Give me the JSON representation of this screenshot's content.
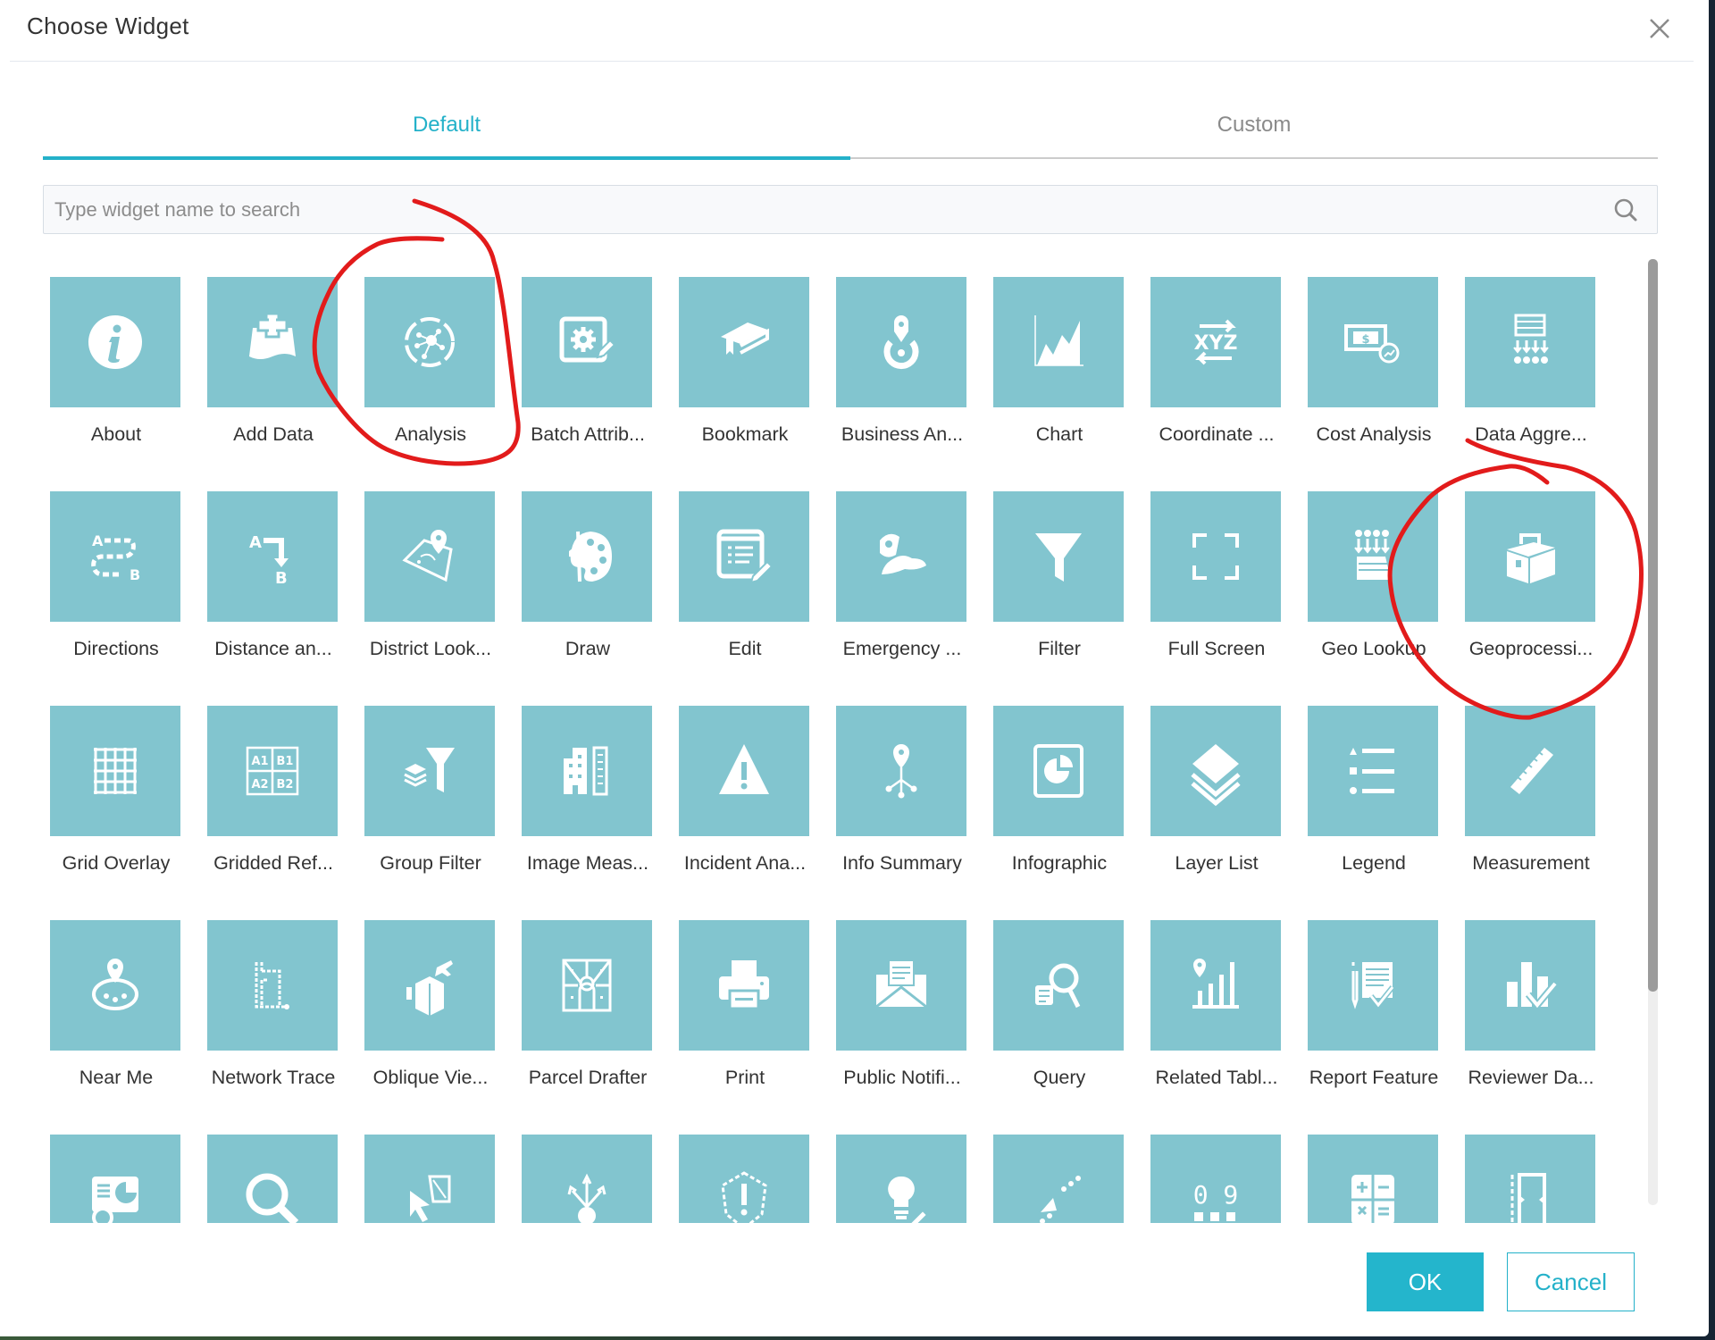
{
  "dialog": {
    "title": "Choose Widget",
    "close_icon": "close-icon"
  },
  "tabs": [
    {
      "label": "Default",
      "active": true
    },
    {
      "label": "Custom",
      "active": false
    }
  ],
  "search": {
    "value": "",
    "placeholder": "Type widget name to search",
    "icon": "search-icon"
  },
  "colors": {
    "accent": "#24b1c9",
    "tile": "#82c5cf",
    "annotation": "#e21b1b"
  },
  "widgets": [
    {
      "label": "About",
      "icon": "info-icon"
    },
    {
      "label": "Add Data",
      "icon": "add-data-icon"
    },
    {
      "label": "Analysis",
      "icon": "analysis-icon",
      "annotated": true
    },
    {
      "label": "Batch Attrib...",
      "icon": "batch-attribute-editor-icon"
    },
    {
      "label": "Bookmark",
      "icon": "bookmark-icon"
    },
    {
      "label": "Business An...",
      "icon": "business-analyst-icon"
    },
    {
      "label": "Chart",
      "icon": "chart-icon"
    },
    {
      "label": "Coordinate ...",
      "icon": "coordinate-conversion-icon"
    },
    {
      "label": "Cost Analysis",
      "icon": "cost-analysis-icon"
    },
    {
      "label": "Data Aggre...",
      "icon": "data-aggregation-icon"
    },
    {
      "label": "Directions",
      "icon": "directions-icon"
    },
    {
      "label": "Distance an...",
      "icon": "distance-direction-icon"
    },
    {
      "label": "District Look...",
      "icon": "district-lookup-icon"
    },
    {
      "label": "Draw",
      "icon": "draw-palette-icon"
    },
    {
      "label": "Edit",
      "icon": "edit-icon"
    },
    {
      "label": "Emergency ...",
      "icon": "emergency-response-icon"
    },
    {
      "label": "Filter",
      "icon": "filter-funnel-icon"
    },
    {
      "label": "Full Screen",
      "icon": "full-screen-icon"
    },
    {
      "label": "Geo Lookup",
      "icon": "geo-lookup-icon"
    },
    {
      "label": "Geoprocessi...",
      "icon": "geoprocessing-toolbox-icon",
      "annotated": true
    },
    {
      "label": "Grid Overlay",
      "icon": "grid-overlay-icon"
    },
    {
      "label": "Gridded Ref...",
      "icon": "gridded-reference-icon"
    },
    {
      "label": "Group Filter",
      "icon": "group-filter-icon"
    },
    {
      "label": "Image Meas...",
      "icon": "image-measurement-icon"
    },
    {
      "label": "Incident Ana...",
      "icon": "incident-analysis-icon"
    },
    {
      "label": "Info Summary",
      "icon": "info-summary-icon"
    },
    {
      "label": "Infographic",
      "icon": "infographic-icon"
    },
    {
      "label": "Layer List",
      "icon": "layer-list-icon"
    },
    {
      "label": "Legend",
      "icon": "legend-icon"
    },
    {
      "label": "Measurement",
      "icon": "measurement-ruler-icon"
    },
    {
      "label": "Near Me",
      "icon": "near-me-icon"
    },
    {
      "label": "Network Trace",
      "icon": "network-trace-icon"
    },
    {
      "label": "Oblique Vie...",
      "icon": "oblique-viewer-icon"
    },
    {
      "label": "Parcel Drafter",
      "icon": "parcel-drafter-icon"
    },
    {
      "label": "Print",
      "icon": "print-icon"
    },
    {
      "label": "Public Notifi...",
      "icon": "public-notification-icon"
    },
    {
      "label": "Query",
      "icon": "query-icon"
    },
    {
      "label": "Related Tabl...",
      "icon": "related-table-charts-icon"
    },
    {
      "label": "Report Feature",
      "icon": "report-feature-icon"
    },
    {
      "label": "Reviewer Da...",
      "icon": "reviewer-dashboard-icon"
    },
    {
      "label": "",
      "icon": "screening-icon"
    },
    {
      "label": "",
      "icon": "search-widget-icon"
    },
    {
      "label": "",
      "icon": "select-icon"
    },
    {
      "label": "",
      "icon": "share-icon"
    },
    {
      "label": "",
      "icon": "situation-awareness-icon"
    },
    {
      "label": "",
      "icon": "smart-editor-icon"
    },
    {
      "label": "",
      "icon": "stream-icon"
    },
    {
      "label": "",
      "icon": "summary-icon"
    },
    {
      "label": "",
      "icon": "calculator-icon"
    },
    {
      "label": "",
      "icon": "swipe-icon"
    }
  ],
  "footer": {
    "ok_label": "OK",
    "cancel_label": "Cancel"
  }
}
